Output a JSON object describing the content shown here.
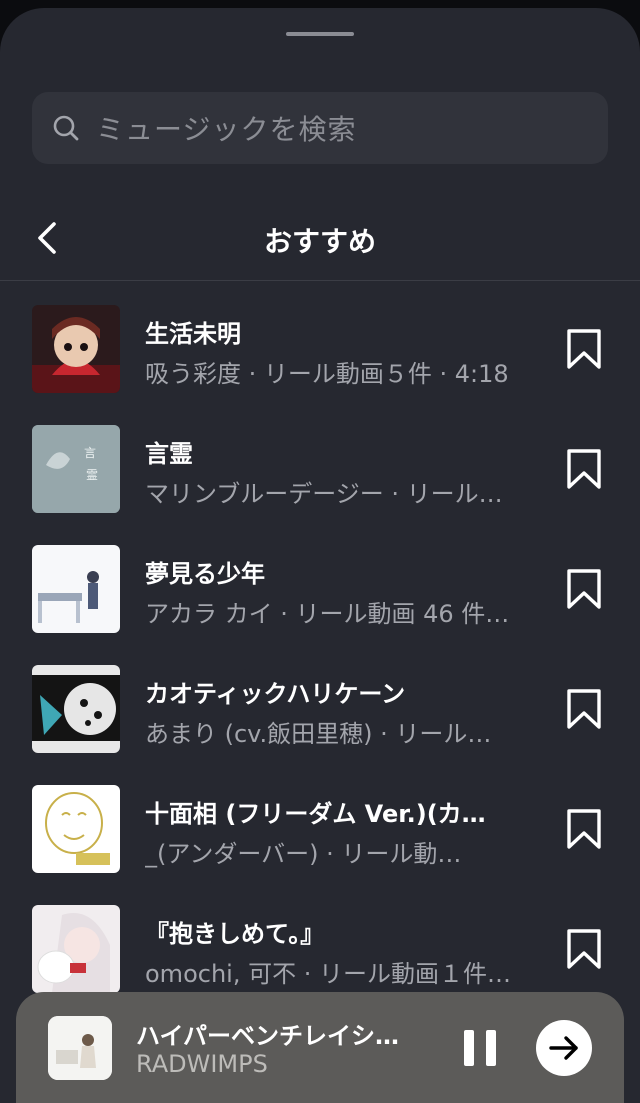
{
  "search": {
    "placeholder": "ミュージックを検索"
  },
  "header": {
    "title": "おすすめ"
  },
  "songs": [
    {
      "title": "生活未明",
      "subtitle": "吸う彩度 · リール動画５件 · 4:18"
    },
    {
      "title": "言霊",
      "subtitle": "マリンブルーデージー · リール…"
    },
    {
      "title": "夢見る少年",
      "subtitle": "アカラ カイ · リール動画 46 件…"
    },
    {
      "title": "カオティックハリケーン",
      "subtitle": "あまり (cv.飯田里穂) · リール…"
    },
    {
      "title": "十面相 (フリーダム Ver.)(カ…",
      "subtitle": "_(アンダーバー) · リール動…"
    },
    {
      "title": "『抱きしめて。』",
      "subtitle": "omochi, 可不 · リール動画１件…"
    }
  ],
  "now_playing": {
    "title": "ハイパーベンチレイシ…",
    "artist": "RADWIMPS"
  },
  "icons": {
    "search": "search-icon",
    "back": "chevron-left-icon",
    "bookmark": "bookmark-icon",
    "pause": "pause-icon",
    "next": "arrow-right-icon"
  },
  "colors": {
    "sheet": "#262830",
    "search_field": "#31333b",
    "secondary_text": "#a3a5ac",
    "player_bar": "#5c5b59"
  }
}
